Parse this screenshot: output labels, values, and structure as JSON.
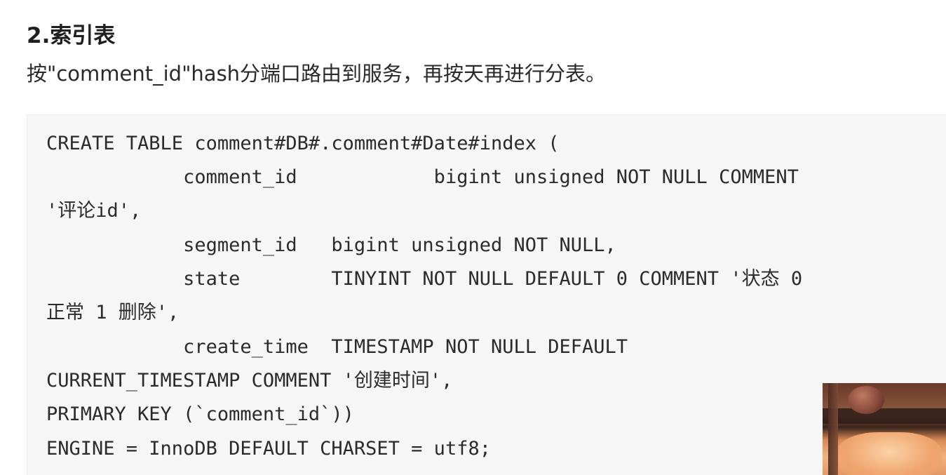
{
  "section": {
    "heading": "2.索引表",
    "description": "按\"comment_id\"hash分端口路由到服务，再按天再进行分表。"
  },
  "code": {
    "lines": [
      "CREATE TABLE comment#DB#.comment#Date#index (",
      "            comment_id            bigint unsigned NOT NULL COMMENT",
      "'评论id',",
      "            segment_id   bigint unsigned NOT NULL,",
      "            state        TINYINT NOT NULL DEFAULT 0 COMMENT '状态 0",
      "正常 1 删除',",
      "            create_time  TIMESTAMP NOT NULL DEFAULT",
      "CURRENT_TIMESTAMP COMMENT '创建时间',",
      "PRIMARY KEY (`comment_id`))",
      "ENGINE = InnoDB DEFAULT CHARSET = utf8;"
    ]
  },
  "colors": {
    "code_background": "#f6f6f7",
    "text": "#2b2b2b"
  },
  "icons": {
    "video_overlay": "webcam-thumbnail"
  }
}
